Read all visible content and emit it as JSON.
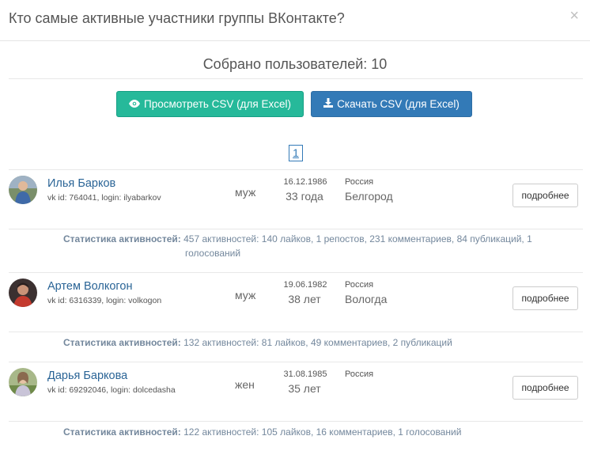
{
  "modal": {
    "title": "Кто самые активные участники группы ВКонтакте?",
    "close": "×"
  },
  "summary": "Собрано пользователей: 10",
  "buttons": {
    "view_csv": "Просмотреть CSV (для Excel)",
    "download_csv": "Скачать CSV (для Excel)"
  },
  "pagination": {
    "current": "1"
  },
  "stats_label": "Статистика активностей:",
  "more_label": "подробнее",
  "users": [
    {
      "name": "Илья Барков",
      "info": "vk id: 764041, login: ilyabarkov",
      "sex": "муж",
      "birthdate": "16.12.1986",
      "age": "33 года",
      "country": "Россия",
      "city": "Белгород",
      "stats_line1": "457 активностей: 140 лайков, 1 репостов, 231 комментариев, 84 публикаций, 1",
      "stats_line2": "голосований"
    },
    {
      "name": "Артем Волкогон",
      "info": "vk id: 6316339, login: volkogon",
      "sex": "муж",
      "birthdate": "19.06.1982",
      "age": "38 лет",
      "country": "Россия",
      "city": "Вологда",
      "stats_line1": "132 активностей: 81 лайков, 49 комментариев, 2 публикаций",
      "stats_line2": ""
    },
    {
      "name": "Дарья Баркова",
      "info": "vk id: 69292046, login: dolcedasha",
      "sex": "жен",
      "birthdate": "31.08.1985",
      "age": "35 лет",
      "country": "Россия",
      "city": "",
      "stats_line1": "122 активностей: 105 лайков, 16 комментариев, 1 голосований",
      "stats_line2": ""
    }
  ]
}
